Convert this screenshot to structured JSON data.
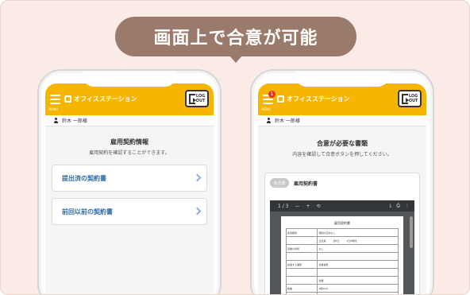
{
  "headline": "画面上で合意が可能",
  "app": {
    "brand": "オフィスステーション",
    "menu_label": "MENU",
    "logout_line1": "LOG",
    "logout_line2": "OUT",
    "user_name": "鈴木 一郎様"
  },
  "left_screen": {
    "title": "雇用契約情報",
    "subtitle": "雇用契約を確認することができます。",
    "cards": [
      {
        "label": "提出済の契約書"
      },
      {
        "label": "前回以前の契約書"
      }
    ]
  },
  "right_screen": {
    "notification_count": "1",
    "title": "合意が必要な書類",
    "subtitle": "内容を確認して合意ボタンを押してください。",
    "document": {
      "status_badge": "未合意",
      "title": "雇用契約書"
    },
    "pdf_viewer": {
      "page_indicator": "1 / 3",
      "zoom_out": "—",
      "zoom_in": "+",
      "page_title": "雇用契約書",
      "rows": [
        [
          "雇用期間",
          "期間の定めなし"
        ],
        [
          "",
          "正社員　　　週5日　　　1日8時間"
        ],
        [
          "就業の場所",
          "なし"
        ],
        [
          "",
          ""
        ],
        [
          "従事する業務",
          "営業事務"
        ],
        [
          "",
          ""
        ],
        [
          "",
          "営業"
        ],
        [
          "始業",
          "9時00分"
        ],
        [
          "終業",
          "18時00分"
        ]
      ]
    }
  },
  "colors": {
    "accent": "#f7b500",
    "bubble": "#9a7a6b",
    "background": "#fbebe6",
    "link": "#2a6aa8"
  }
}
